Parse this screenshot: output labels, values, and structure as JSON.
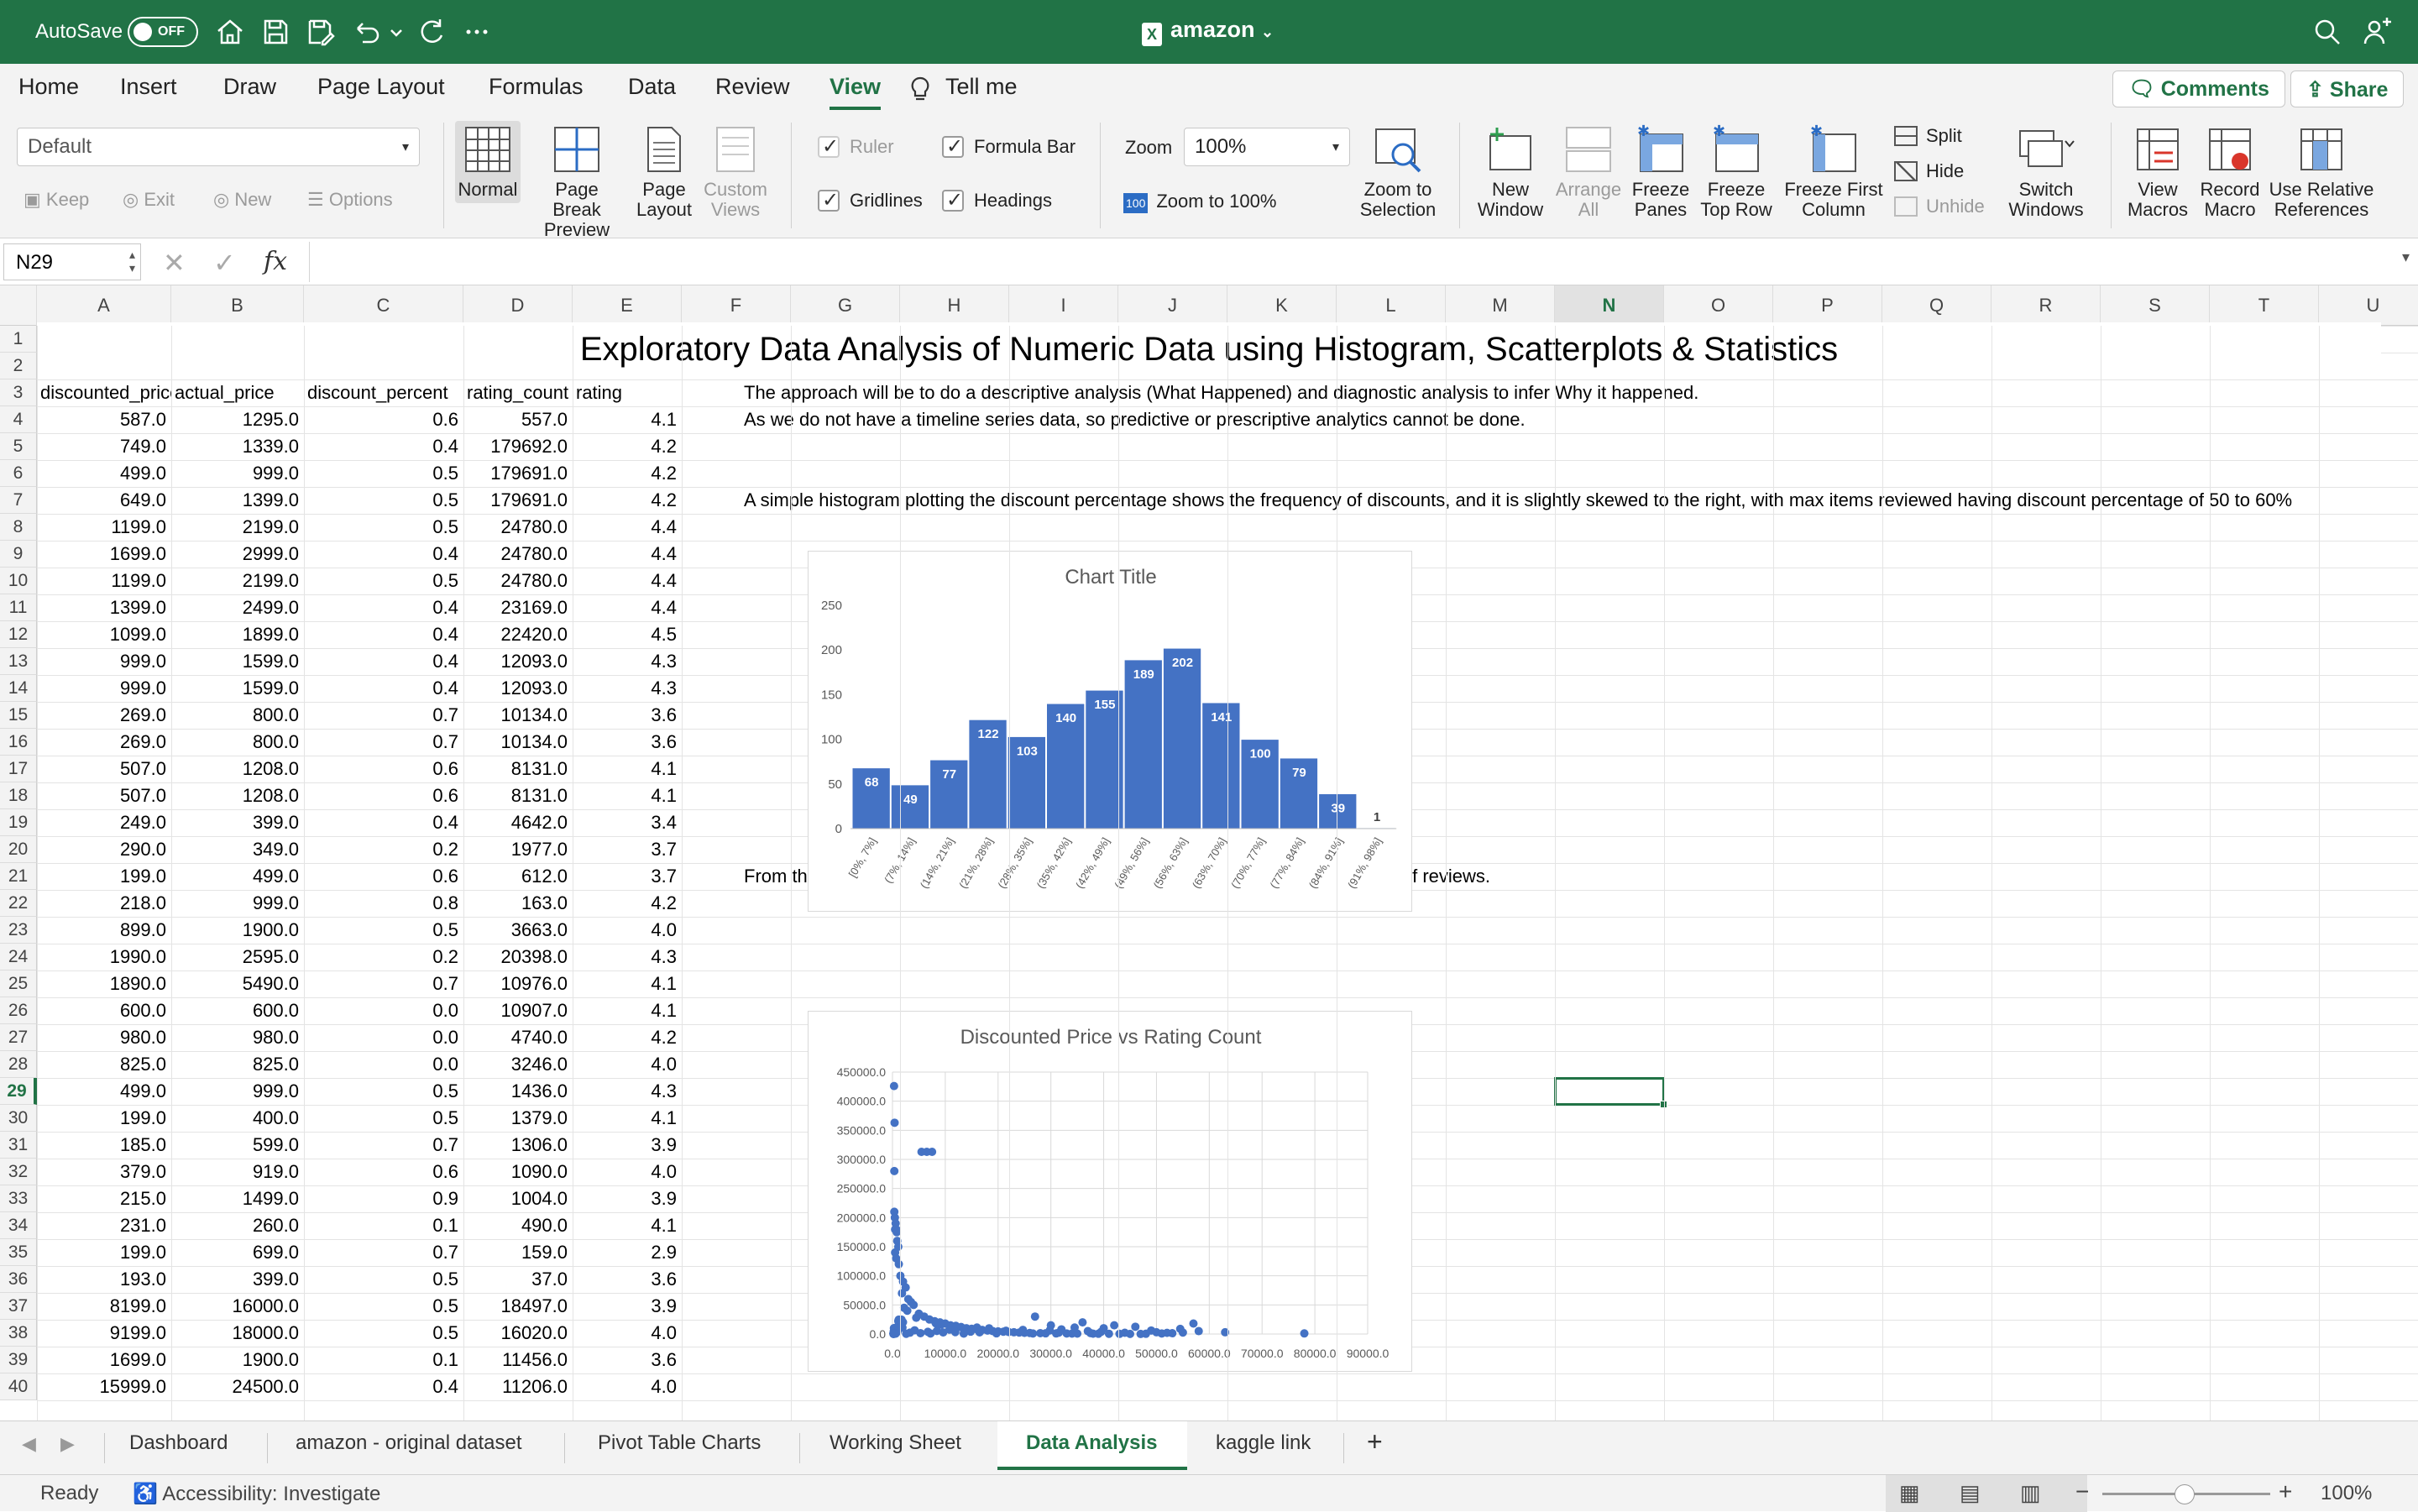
{
  "titlebar": {
    "autosave_label": "AutoSave",
    "autosave_state": "OFF",
    "document_name": "amazon",
    "icons": [
      "home-icon",
      "save-icon",
      "save-as-icon",
      "undo-icon",
      "redo-icon",
      "more-icon",
      "search-icon",
      "share-people-icon"
    ]
  },
  "menu": {
    "tabs": [
      "Home",
      "Insert",
      "Draw",
      "Page Layout",
      "Formulas",
      "Data",
      "Review",
      "View"
    ],
    "active_tab": "View",
    "tell_me": "Tell me",
    "comments": "Comments",
    "share": "Share"
  },
  "ribbon": {
    "sheet_view_select": "Default",
    "keep": "Keep",
    "exit": "Exit",
    "new": "New",
    "options": "Options",
    "normal": "Normal",
    "page_break_preview_1": "Page Break",
    "page_break_preview_2": "Preview",
    "page_layout_1": "Page",
    "page_layout_2": "Layout",
    "custom_views_1": "Custom",
    "custom_views_2": "Views",
    "ruler": "Ruler",
    "formula_bar": "Formula Bar",
    "gridlines": "Gridlines",
    "headings": "Headings",
    "zoom_label": "Zoom",
    "zoom_value": "100%",
    "zoom_to_100": "Zoom to 100%",
    "zoom_to_selection_1": "Zoom to",
    "zoom_to_selection_2": "Selection",
    "new_window_1": "New",
    "new_window_2": "Window",
    "arrange_all_1": "Arrange",
    "arrange_all_2": "All",
    "freeze_panes_1": "Freeze",
    "freeze_panes_2": "Panes",
    "freeze_top_row_1": "Freeze",
    "freeze_top_row_2": "Top Row",
    "freeze_first_col_1": "Freeze First",
    "freeze_first_col_2": "Column",
    "split": "Split",
    "hide": "Hide",
    "unhide": "Unhide",
    "switch_windows_1": "Switch",
    "switch_windows_2": "Windows",
    "view_macros_1": "View",
    "view_macros_2": "Macros",
    "record_macro_1": "Record",
    "record_macro_2": "Macro",
    "use_relative_1": "Use Relative",
    "use_relative_2": "References"
  },
  "formula_bar": {
    "name_box": "N29",
    "fx": "fx",
    "content": ""
  },
  "grid": {
    "columns": [
      "A",
      "B",
      "C",
      "D",
      "E",
      "F",
      "G",
      "H",
      "I",
      "J",
      "K",
      "L",
      "M",
      "N",
      "O",
      "P",
      "Q",
      "R",
      "S",
      "T",
      "U"
    ],
    "selected_column": "N",
    "selected_row": "29",
    "rows": [
      "1",
      "2",
      "3",
      "4",
      "5",
      "6",
      "7",
      "8",
      "9",
      "10",
      "11",
      "12",
      "13",
      "14",
      "15",
      "16",
      "17",
      "18",
      "19",
      "20",
      "21",
      "22",
      "23",
      "24",
      "25",
      "26",
      "27",
      "28",
      "29",
      "30",
      "31",
      "32",
      "33",
      "34",
      "35",
      "36",
      "37",
      "38",
      "39",
      "40"
    ],
    "title": "Exploratory Data Analysis of Numeric Data using Histogram, Scatterplots & Statistics",
    "headers": [
      "discounted_price",
      "actual_price",
      "discount_percent",
      "rating_count",
      "rating"
    ],
    "data": [
      [
        "587.0",
        "1295.0",
        "0.6",
        "557.0",
        "4.1"
      ],
      [
        "749.0",
        "1339.0",
        "0.4",
        "179692.0",
        "4.2"
      ],
      [
        "499.0",
        "999.0",
        "0.5",
        "179691.0",
        "4.2"
      ],
      [
        "649.0",
        "1399.0",
        "0.5",
        "179691.0",
        "4.2"
      ],
      [
        "1199.0",
        "2199.0",
        "0.5",
        "24780.0",
        "4.4"
      ],
      [
        "1699.0",
        "2999.0",
        "0.4",
        "24780.0",
        "4.4"
      ],
      [
        "1199.0",
        "2199.0",
        "0.5",
        "24780.0",
        "4.4"
      ],
      [
        "1399.0",
        "2499.0",
        "0.4",
        "23169.0",
        "4.4"
      ],
      [
        "1099.0",
        "1899.0",
        "0.4",
        "22420.0",
        "4.5"
      ],
      [
        "999.0",
        "1599.0",
        "0.4",
        "12093.0",
        "4.3"
      ],
      [
        "999.0",
        "1599.0",
        "0.4",
        "12093.0",
        "4.3"
      ],
      [
        "269.0",
        "800.0",
        "0.7",
        "10134.0",
        "3.6"
      ],
      [
        "269.0",
        "800.0",
        "0.7",
        "10134.0",
        "3.6"
      ],
      [
        "507.0",
        "1208.0",
        "0.6",
        "8131.0",
        "4.1"
      ],
      [
        "507.0",
        "1208.0",
        "0.6",
        "8131.0",
        "4.1"
      ],
      [
        "249.0",
        "399.0",
        "0.4",
        "4642.0",
        "3.4"
      ],
      [
        "290.0",
        "349.0",
        "0.2",
        "1977.0",
        "3.7"
      ],
      [
        "199.0",
        "499.0",
        "0.6",
        "612.0",
        "3.7"
      ],
      [
        "218.0",
        "999.0",
        "0.8",
        "163.0",
        "4.2"
      ],
      [
        "899.0",
        "1900.0",
        "0.5",
        "3663.0",
        "4.0"
      ],
      [
        "1990.0",
        "2595.0",
        "0.2",
        "20398.0",
        "4.3"
      ],
      [
        "1890.0",
        "5490.0",
        "0.7",
        "10976.0",
        "4.1"
      ],
      [
        "600.0",
        "600.0",
        "0.0",
        "10907.0",
        "4.1"
      ],
      [
        "980.0",
        "980.0",
        "0.0",
        "4740.0",
        "4.2"
      ],
      [
        "825.0",
        "825.0",
        "0.0",
        "3246.0",
        "4.0"
      ],
      [
        "499.0",
        "999.0",
        "0.5",
        "1436.0",
        "4.3"
      ],
      [
        "199.0",
        "400.0",
        "0.5",
        "1379.0",
        "4.1"
      ],
      [
        "185.0",
        "599.0",
        "0.7",
        "1306.0",
        "3.9"
      ],
      [
        "379.0",
        "919.0",
        "0.6",
        "1090.0",
        "4.0"
      ],
      [
        "215.0",
        "1499.0",
        "0.9",
        "1004.0",
        "3.9"
      ],
      [
        "231.0",
        "260.0",
        "0.1",
        "490.0",
        "4.1"
      ],
      [
        "199.0",
        "699.0",
        "0.7",
        "159.0",
        "2.9"
      ],
      [
        "193.0",
        "399.0",
        "0.5",
        "37.0",
        "3.6"
      ],
      [
        "8199.0",
        "16000.0",
        "0.5",
        "18497.0",
        "3.9"
      ],
      [
        "9199.0",
        "18000.0",
        "0.5",
        "16020.0",
        "4.0"
      ],
      [
        "1699.0",
        "1900.0",
        "0.1",
        "11456.0",
        "3.6"
      ],
      [
        "15999.0",
        "24500.0",
        "0.4",
        "11206.0",
        "4.0"
      ]
    ],
    "notes": [
      "The approach will be to do a descriptive analysis (What Happened) and diagnostic analysis to infer Why it happened.",
      "As we do not have a timeline series data, so predictive or prescriptive analytics cannot be done.",
      "A simple histogram plotting the discount percentage shows the frequency of discounts, and it is slightly skewed to the right, with max items reviewed having discount percentage of 50 to 60%",
      "From the below scatterplot, we can infer that the price is influenced by the count of reviews."
    ]
  },
  "chart_data": [
    {
      "type": "bar",
      "title": "Chart Title",
      "categories": [
        "[0%, 7%]",
        "(7%, 14%]",
        "(14%, 21%]",
        "(21%, 28%]",
        "(28%, 35%]",
        "(35%, 42%]",
        "(42%, 49%]",
        "(49%, 56%]",
        "(56%, 63%]",
        "(63%, 70%]",
        "(70%, 77%]",
        "(77%, 84%]",
        "(84%, 91%]",
        "(91%, 98%]"
      ],
      "values": [
        68,
        49,
        77,
        122,
        103,
        140,
        155,
        189,
        202,
        141,
        100,
        79,
        39,
        1
      ],
      "ylim": [
        0,
        250
      ],
      "yticks": [
        "0",
        "50",
        "100",
        "150",
        "200",
        "250"
      ],
      "color": "#4472c4",
      "grid": false
    },
    {
      "type": "scatter",
      "title": "Discounted Price vs Rating Count",
      "xlim": [
        0,
        90000
      ],
      "ylim": [
        0,
        450000
      ],
      "xticks": [
        "0.0",
        "10000.0",
        "20000.0",
        "30000.0",
        "40000.0",
        "50000.0",
        "60000.0",
        "70000.0",
        "80000.0",
        "90000.0"
      ],
      "yticks": [
        "0.0",
        "50000.0",
        "100000.0",
        "150000.0",
        "200000.0",
        "250000.0",
        "300000.0",
        "350000.0",
        "400000.0",
        "450000.0"
      ],
      "color": "#4472c4",
      "grid": true,
      "points": [
        [
          587,
          557
        ],
        [
          749,
          179692
        ],
        [
          499,
          179691
        ],
        [
          649,
          179691
        ],
        [
          1199,
          24780
        ],
        [
          1699,
          24780
        ],
        [
          1399,
          23169
        ],
        [
          1099,
          22420
        ],
        [
          999,
          12093
        ],
        [
          269,
          10134
        ],
        [
          507,
          8131
        ],
        [
          249,
          4642
        ],
        [
          290,
          1977
        ],
        [
          199,
          612
        ],
        [
          218,
          163
        ],
        [
          899,
          3663
        ],
        [
          1990,
          20398
        ],
        [
          1890,
          10976
        ],
        [
          600,
          10907
        ],
        [
          980,
          4740
        ],
        [
          825,
          3246
        ],
        [
          499,
          1436
        ],
        [
          199,
          1379
        ],
        [
          185,
          1306
        ],
        [
          379,
          1090
        ],
        [
          215,
          1004
        ],
        [
          231,
          490
        ],
        [
          193,
          37
        ],
        [
          8199,
          18497
        ],
        [
          9199,
          16020
        ],
        [
          1699,
          11456
        ],
        [
          15999,
          11206
        ],
        [
          300,
          426000
        ],
        [
          400,
          363000
        ],
        [
          350,
          280000
        ],
        [
          5500,
          313000
        ],
        [
          6500,
          313000
        ],
        [
          7500,
          313000
        ],
        [
          350,
          210000
        ],
        [
          450,
          200000
        ],
        [
          600,
          190000
        ],
        [
          800,
          175000
        ],
        [
          900,
          160000
        ],
        [
          1100,
          150000
        ],
        [
          500,
          140000
        ],
        [
          700,
          130000
        ],
        [
          1200,
          120000
        ],
        [
          1500,
          100000
        ],
        [
          2000,
          90000
        ],
        [
          2500,
          80000
        ],
        [
          1800,
          70000
        ],
        [
          3000,
          60000
        ],
        [
          3500,
          55000
        ],
        [
          4000,
          50000
        ],
        [
          2200,
          45000
        ],
        [
          2800,
          40000
        ],
        [
          5000,
          35000
        ],
        [
          6000,
          30000
        ],
        [
          4500,
          28000
        ],
        [
          7000,
          25000
        ],
        [
          8000,
          22000
        ],
        [
          9000,
          20000
        ],
        [
          10000,
          18000
        ],
        [
          11000,
          15000
        ],
        [
          12000,
          14000
        ],
        [
          13000,
          12000
        ],
        [
          14000,
          10000
        ],
        [
          15000,
          9000
        ],
        [
          16000,
          8000
        ],
        [
          17000,
          7000
        ],
        [
          18000,
          6000
        ],
        [
          19000,
          5000
        ],
        [
          20000,
          4500
        ],
        [
          21000,
          4000
        ],
        [
          22000,
          3500
        ],
        [
          23000,
          3000
        ],
        [
          24000,
          2500
        ],
        [
          25000,
          2000
        ],
        [
          26000,
          1800
        ],
        [
          27000,
          30000
        ],
        [
          28000,
          1500
        ],
        [
          29000,
          1200
        ],
        [
          30000,
          15000
        ],
        [
          31000,
          1000
        ],
        [
          32000,
          8000
        ],
        [
          33000,
          900
        ],
        [
          34000,
          800
        ],
        [
          35000,
          700
        ],
        [
          36000,
          20000
        ],
        [
          37000,
          5000
        ],
        [
          38000,
          600
        ],
        [
          39000,
          500
        ],
        [
          40000,
          10000
        ],
        [
          41000,
          400
        ],
        [
          42000,
          15000
        ],
        [
          43000,
          300
        ],
        [
          45000,
          200
        ],
        [
          47000,
          100
        ],
        [
          48000,
          500
        ],
        [
          49000,
          6000
        ],
        [
          50000,
          3000
        ],
        [
          52000,
          2000
        ],
        [
          55000,
          2500
        ],
        [
          57000,
          18000
        ],
        [
          58000,
          5000
        ],
        [
          63000,
          3000
        ],
        [
          78000,
          1000
        ],
        [
          2600,
          400
        ],
        [
          3300,
          2300
        ],
        [
          4200,
          6400
        ],
        [
          5300,
          1500
        ],
        [
          6700,
          3800
        ],
        [
          7200,
          900
        ],
        [
          8400,
          5200
        ],
        [
          9600,
          2700
        ],
        [
          10800,
          7600
        ],
        [
          11900,
          3300
        ],
        [
          13500,
          800
        ],
        [
          14800,
          4100
        ],
        [
          16500,
          2900
        ],
        [
          18300,
          9800
        ],
        [
          19700,
          1200
        ],
        [
          21500,
          5500
        ],
        [
          24700,
          7100
        ],
        [
          26600,
          900
        ],
        [
          29800,
          6200
        ],
        [
          31500,
          2400
        ],
        [
          34500,
          11200
        ],
        [
          37500,
          1700
        ],
        [
          39500,
          3600
        ],
        [
          44000,
          2100
        ],
        [
          46000,
          12500
        ],
        [
          51000,
          900
        ],
        [
          53000,
          1400
        ],
        [
          54500,
          8800
        ]
      ]
    }
  ],
  "sheet_tabs": {
    "tabs": [
      "Dashboard",
      "amazon - original dataset",
      "Pivot Table Charts",
      "Working Sheet",
      "Data Analysis",
      "kaggle link"
    ],
    "active": "Data Analysis",
    "add": "+"
  },
  "status_bar": {
    "ready": "Ready",
    "accessibility": "Accessibility: Investigate",
    "zoom": "100%"
  }
}
